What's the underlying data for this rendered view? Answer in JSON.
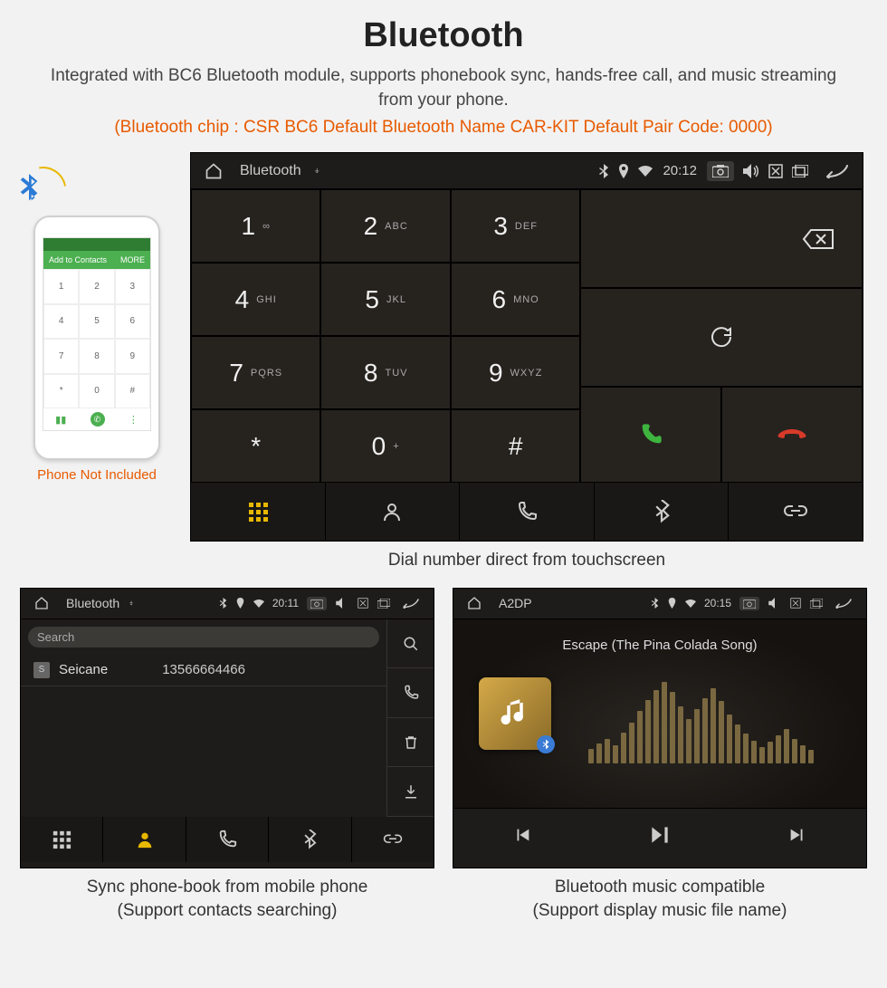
{
  "header": {
    "title": "Bluetooth",
    "subtitle": "Integrated with BC6 Bluetooth module, supports phonebook sync, hands-free call, and music streaming from your phone.",
    "specs": "(Bluetooth chip : CSR BC6     Default Bluetooth Name CAR-KIT     Default Pair Code: 0000)"
  },
  "phone": {
    "addContacts": "Add to Contacts",
    "more": "MORE",
    "caption": "Phone Not Included"
  },
  "dialer": {
    "status": {
      "title": "Bluetooth",
      "time": "20:12"
    },
    "keys": [
      {
        "d": "1",
        "l": "∞"
      },
      {
        "d": "2",
        "l": "ABC"
      },
      {
        "d": "3",
        "l": "DEF"
      },
      {
        "d": "4",
        "l": "GHI"
      },
      {
        "d": "5",
        "l": "JKL"
      },
      {
        "d": "6",
        "l": "MNO"
      },
      {
        "d": "7",
        "l": "PQRS"
      },
      {
        "d": "8",
        "l": "TUV"
      },
      {
        "d": "9",
        "l": "WXYZ"
      },
      {
        "d": "*",
        "l": ""
      },
      {
        "d": "0",
        "l": "+"
      },
      {
        "d": "#",
        "l": ""
      }
    ],
    "caption": "Dial number direct from touchscreen"
  },
  "phonebook": {
    "status": {
      "title": "Bluetooth",
      "time": "20:11"
    },
    "searchPlaceholder": "Search",
    "contact": {
      "tag": "S",
      "name": "Seicane",
      "number": "13566664466"
    },
    "caption1": "Sync phone-book from mobile phone",
    "caption2": "(Support contacts searching)"
  },
  "a2dp": {
    "status": {
      "title": "A2DP",
      "time": "20:15"
    },
    "track": "Escape (The Pina Colada Song)",
    "caption1": "Bluetooth music compatible",
    "caption2": "(Support display music file name)"
  }
}
